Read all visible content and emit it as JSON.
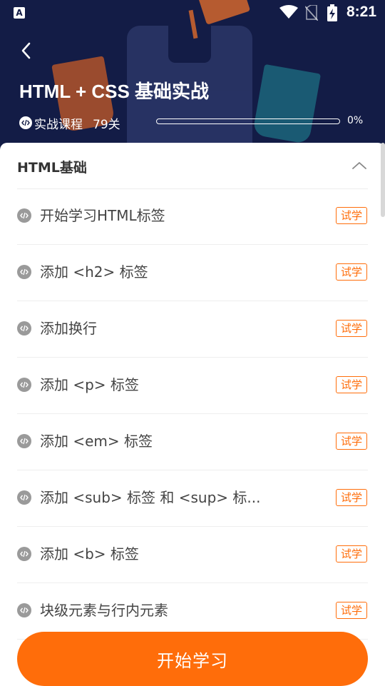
{
  "status_bar": {
    "time": "8:21",
    "app_icon_letter": "A",
    "icons": [
      "wifi-icon",
      "no-sim-icon",
      "battery-charging-icon"
    ]
  },
  "header": {
    "back_icon": "chevron-left-icon",
    "title": "HTML + CSS 基础实战",
    "course_type": "实战课程",
    "lesson_count": "79关",
    "progress": 0,
    "progress_text": "0%",
    "background_color": "#131c46"
  },
  "section": {
    "title": "HTML基础",
    "toggle_icon": "chevron-up-icon"
  },
  "lessons": [
    {
      "title": "开始学习HTML标签",
      "badge": "试学"
    },
    {
      "title": "添加 <h2> 标签",
      "badge": "试学"
    },
    {
      "title": "添加换行",
      "badge": "试学"
    },
    {
      "title": "添加 <p> 标签",
      "badge": "试学"
    },
    {
      "title": "添加 <em> 标签",
      "badge": "试学"
    },
    {
      "title": "添加 <sub> 标签 和 <sup> 标...",
      "badge": "试学"
    },
    {
      "title": "添加 <b> 标签",
      "badge": "试学"
    },
    {
      "title": "块级元素与行内元素",
      "badge": "试学"
    }
  ],
  "start_button": {
    "label": "开始学习"
  },
  "colors": {
    "accent": "#ff6d0a",
    "header_bg": "#131c46",
    "text_dark": "#333333",
    "text_muted": "#444444"
  }
}
